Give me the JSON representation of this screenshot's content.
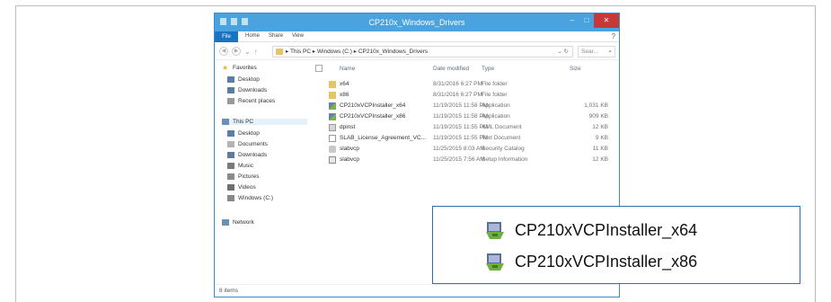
{
  "window": {
    "title": "CP210x_Windows_Drivers",
    "controls": {
      "minimize": "–",
      "maximize": "□",
      "close": "✕"
    }
  },
  "ribbon": {
    "file_tab": "File",
    "tabs": [
      "Home",
      "Share",
      "View"
    ],
    "help_icon": "?"
  },
  "address": {
    "path": "▸ This PC ▸ Windows (C:) ▸ CP210x_Windows_Drivers",
    "search_placeholder": "Sear..."
  },
  "nav_pane": {
    "favorites": "Favorites",
    "favorites_items": [
      "Desktop",
      "Downloads",
      "Recent places"
    ],
    "this_pc": "This PC",
    "this_pc_items": [
      "Desktop",
      "Documents",
      "Downloads",
      "Music",
      "Pictures",
      "Videos",
      "Windows (C:)"
    ],
    "network": "Network"
  },
  "columns": {
    "name": "Name",
    "date": "Date modified",
    "type": "Type",
    "size": "Size"
  },
  "files": [
    {
      "name": "x64",
      "date": "8/31/2016 6:27 PM",
      "type": "File folder",
      "size": "",
      "icon": "folder-icon"
    },
    {
      "name": "x86",
      "date": "8/31/2016 6:27 PM",
      "type": "File folder",
      "size": "",
      "icon": "folder-icon"
    },
    {
      "name": "CP210xVCPInstaller_x64",
      "date": "11/19/2015 11:58 PM",
      "type": "Application",
      "size": "1,031 KB",
      "icon": "installer-icon"
    },
    {
      "name": "CP210xVCPInstaller_x86",
      "date": "11/19/2015 11:58 PM",
      "type": "Application",
      "size": "909 KB",
      "icon": "installer-icon"
    },
    {
      "name": "dpinst",
      "date": "11/19/2015 11:55 PM",
      "type": "XML Document",
      "size": "12 KB",
      "icon": "xml-icon"
    },
    {
      "name": "SLAB_License_Agreement_VC...",
      "date": "11/19/2015 11:55 PM",
      "type": "Text Document",
      "size": "9 KB",
      "icon": "text-icon"
    },
    {
      "name": "slabvcp",
      "date": "11/25/2015 8:03 AM",
      "type": "Security Catalog",
      "size": "11 KB",
      "icon": "catalog-icon"
    },
    {
      "name": "slabvcp",
      "date": "11/25/2015 7:56 AM",
      "type": "Setup Information",
      "size": "12 KB",
      "icon": "setup-icon"
    }
  ],
  "status": {
    "items": "8 items"
  },
  "callout": {
    "items": [
      "CP210xVCPInstaller_x64",
      "CP210xVCPInstaller_x86"
    ]
  },
  "colors": {
    "titlebar": "#4aa3df",
    "file_tab": "#1a74c4",
    "close": "#c7383a",
    "callout_border": "#2f6fb3"
  }
}
